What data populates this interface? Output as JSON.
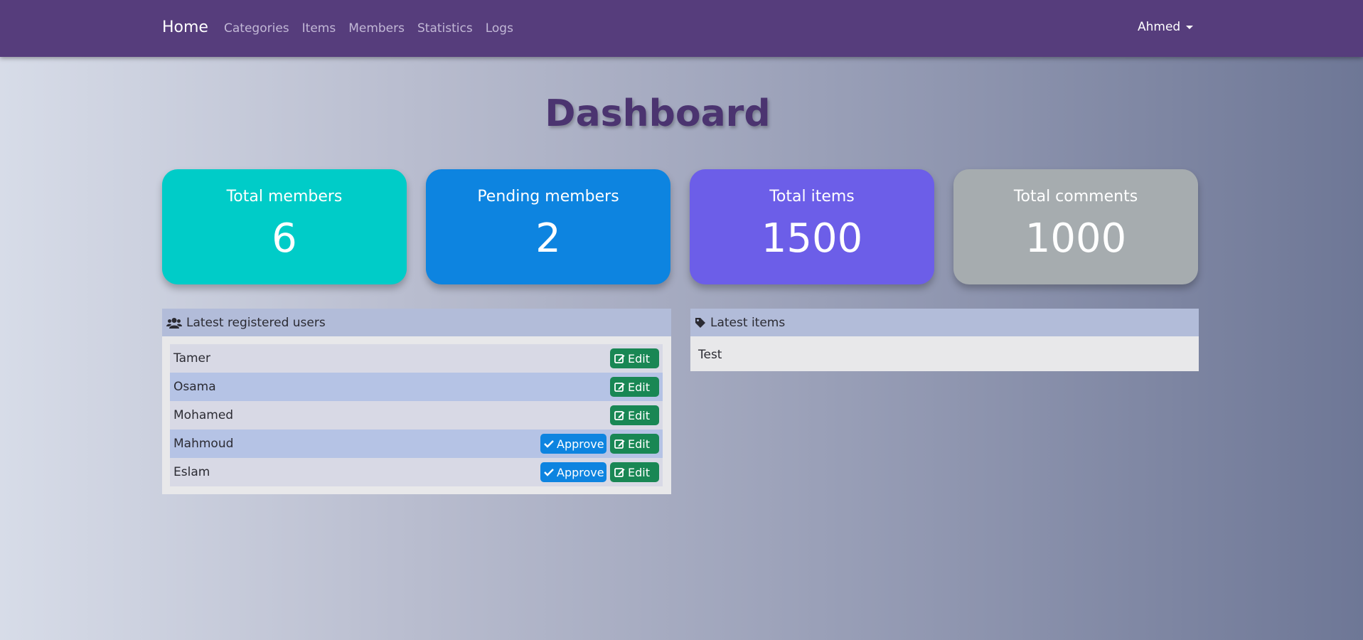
{
  "nav": {
    "brand": "Home",
    "links": [
      "Categories",
      "Items",
      "Members",
      "Statistics",
      "Logs"
    ],
    "user": "Ahmed"
  },
  "page_title": "Dashboard",
  "stats": [
    {
      "label": "Total members",
      "value": "6",
      "color": "#00ccc8"
    },
    {
      "label": "Pending members",
      "value": "2",
      "color": "#0d84e0"
    },
    {
      "label": "Total items",
      "value": "1500",
      "color": "#6c5ee8"
    },
    {
      "label": "Total comments",
      "value": "1000",
      "color": "#a6acaf"
    }
  ],
  "latest_users": {
    "title": "Latest registered users",
    "icon": "users-icon",
    "rows": [
      {
        "name": "Tamer",
        "approve": false
      },
      {
        "name": "Osama",
        "approve": false
      },
      {
        "name": "Mohamed",
        "approve": false
      },
      {
        "name": "Mahmoud",
        "approve": true
      },
      {
        "name": "Eslam",
        "approve": true
      }
    ],
    "edit_label": "Edit",
    "approve_label": "Approve"
  },
  "latest_items": {
    "title": "Latest items",
    "icon": "tag-icon",
    "rows": [
      "Test"
    ]
  }
}
